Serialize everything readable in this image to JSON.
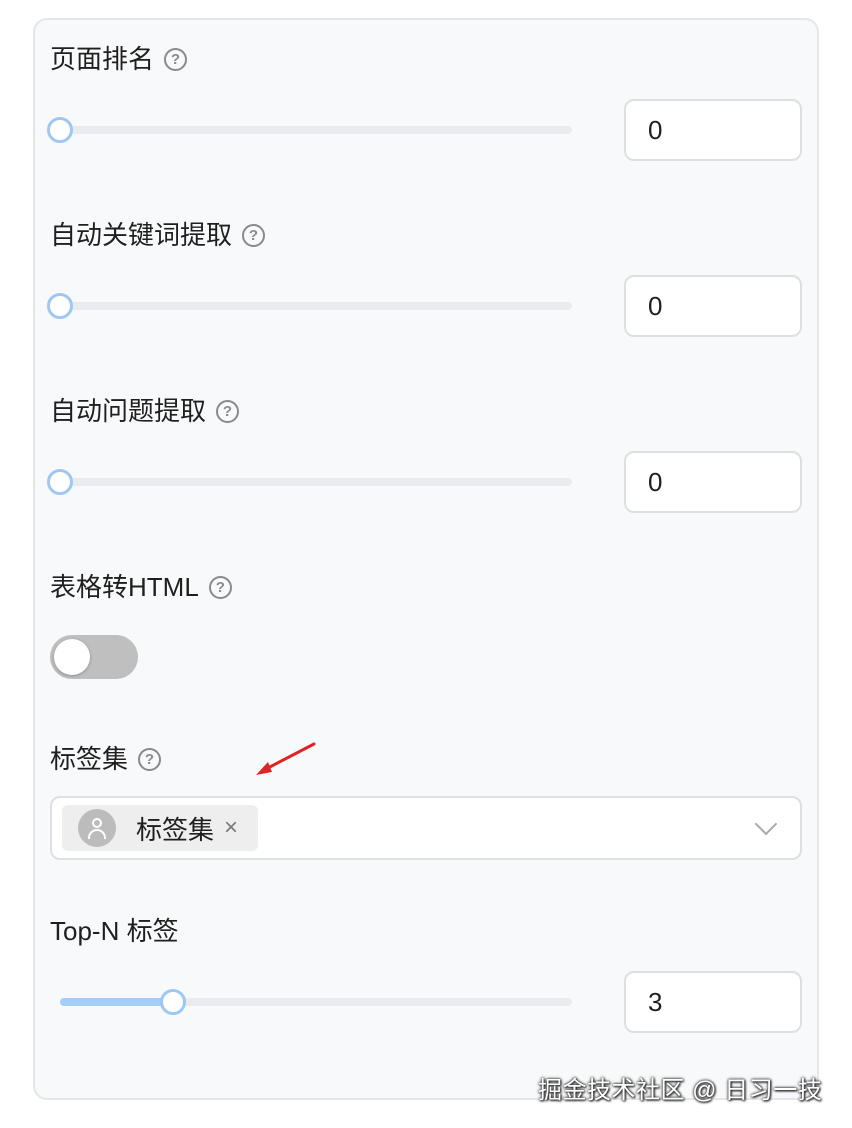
{
  "help_icon_glyph": "?",
  "page_rank": {
    "label": "页面排名",
    "value": "0",
    "slider_fraction": 0.0
  },
  "auto_keywords": {
    "label": "自动关键词提取",
    "value": "0",
    "slider_fraction": 0.0
  },
  "auto_questions": {
    "label": "自动问题提取",
    "value": "0",
    "slider_fraction": 0.0
  },
  "table_to_html": {
    "label": "表格转HTML",
    "enabled": false
  },
  "tag_set": {
    "label": "标签集",
    "selected_tags": [
      {
        "label": "标签集",
        "icon": "user-avatar-icon",
        "remove_glyph": "×"
      }
    ],
    "dropdown_icon": "chevron-down-icon"
  },
  "top_n_tags": {
    "label": "Top-N 标签",
    "value": "3",
    "slider_fraction": 0.22
  },
  "annotation": {
    "icon": "red-arrow-icon",
    "color": "#e02424"
  },
  "watermark": "掘金技术社区 @ 日习一技",
  "colors": {
    "slider_track": "#e9ebee",
    "slider_fill": "#a5cdf7",
    "slider_thumb_border": "#9ec8f3",
    "toggle_off": "#bfbfbf",
    "panel_bg": "#f8f9fb"
  }
}
